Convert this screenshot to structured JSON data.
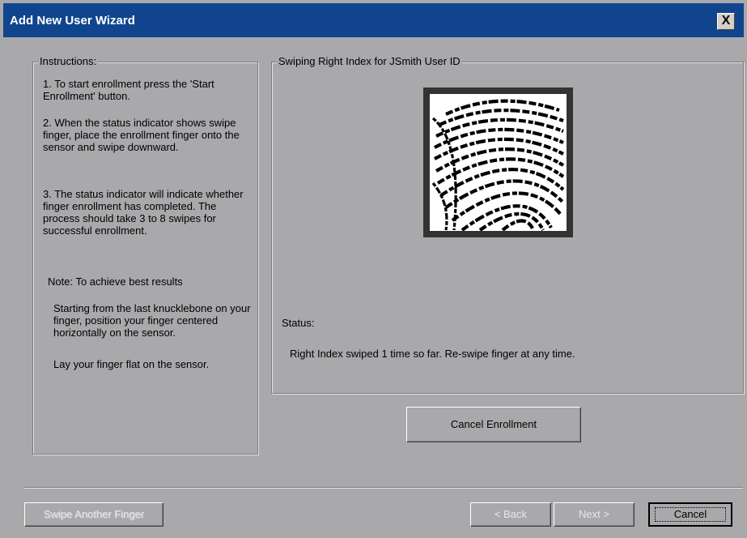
{
  "window": {
    "title": "Add New User Wizard",
    "close_label": "X"
  },
  "instructions": {
    "legend": "Instructions:",
    "step1": "1. To start enrollment press the 'Start Enrollment' button.",
    "step2": "2. When the status indicator shows swipe finger, place the enrollment finger onto the sensor and swipe downward.",
    "step3": "3. The status indicator will indicate whether finger enrollment has completed.  The process should take 3 to 8 swipes for successful enrollment.",
    "note": "Note: To achieve best results",
    "tip1": "Starting from the last knucklebone on your finger, position your finger centered horizontally on the sensor.",
    "tip2": "Lay your finger flat on the sensor."
  },
  "enrollment": {
    "legend": "Swiping Right Index for JSmith User ID",
    "image_icon": "fingerprint-image",
    "status_label": "Status:",
    "status_text": "Right Index swiped 1 time so far.  Re-swipe finger at any time."
  },
  "buttons": {
    "cancel_enrollment": "Cancel Enrollment",
    "swipe_another": "Swipe Another Finger",
    "back": "< Back",
    "next": "Next >",
    "cancel": "Cancel"
  },
  "colors": {
    "titlebar": "#10458e",
    "dialog_bg": "#a9a9ac"
  }
}
